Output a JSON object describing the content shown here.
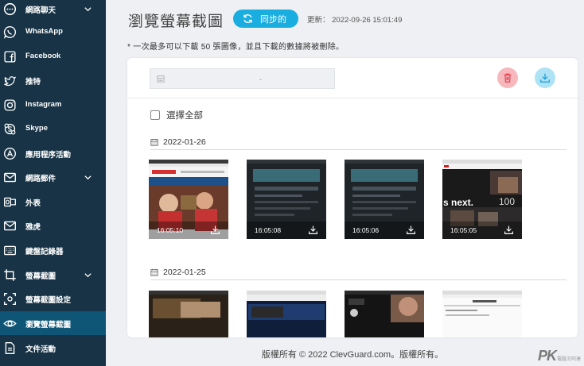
{
  "sidebar": {
    "items": [
      {
        "label": "網路聊天",
        "icon": "chat-bubble-icon",
        "has_chevron": true
      },
      {
        "label": "WhatsApp",
        "icon": "whatsapp-icon"
      },
      {
        "label": "Facebook",
        "icon": "facebook-icon"
      },
      {
        "label": "推特",
        "icon": "twitter-icon"
      },
      {
        "label": "Instagram",
        "icon": "instagram-icon"
      },
      {
        "label": "Skype",
        "icon": "skype-icon"
      },
      {
        "label": "應用程序活動",
        "icon": "app-store-icon"
      },
      {
        "label": "網路郵件",
        "icon": "mail-icon",
        "has_chevron": true
      },
      {
        "label": "外表",
        "icon": "outlook-icon"
      },
      {
        "label": "雅虎",
        "icon": "envelope-icon"
      },
      {
        "label": "鍵盤記錄器",
        "icon": "keyboard-icon"
      },
      {
        "label": "螢幕截圖",
        "icon": "crop-icon",
        "has_chevron": true
      },
      {
        "label": "螢幕截圖設定",
        "icon": "screenshot-settings-icon"
      },
      {
        "label": "瀏覽螢幕截圖",
        "icon": "eye-icon",
        "active": true
      },
      {
        "label": "文件活動",
        "icon": "file-icon"
      }
    ]
  },
  "header": {
    "title": "瀏覽螢幕截圖",
    "sync_label": "同步的",
    "update_text": "更新： 2022-09-26 15:01:49"
  },
  "notice": "* 一次最多可以下載 50 張圖像，並且下載的數據將被刪除。",
  "toolbar": {
    "search_dash": "-",
    "delete_icon": "trash-icon",
    "download_icon": "download-icon"
  },
  "select_all_label": "選擇全部",
  "groups": [
    {
      "date": "2022-01-26",
      "thumbnails": [
        {
          "time": "16:05:10"
        },
        {
          "time": "16:05:08"
        },
        {
          "time": "16:05:06"
        },
        {
          "time": "16:05:05",
          "text": "s next.",
          "text2": "100"
        }
      ]
    },
    {
      "date": "2022-01-25",
      "thumbnails": [
        {},
        {},
        {},
        {}
      ]
    }
  ],
  "footer": "版權所有 © 2022 ClevGuard.com。版權所有。",
  "watermark": {
    "brand": "PK",
    "sub": "電腦王阿達"
  },
  "colors": {
    "sidebar_bg": "#173345",
    "sidebar_active": "#0f5575",
    "accent": "#1aaee0",
    "delete_bg": "#f7b8bd",
    "download_bg": "#aee3f6"
  }
}
